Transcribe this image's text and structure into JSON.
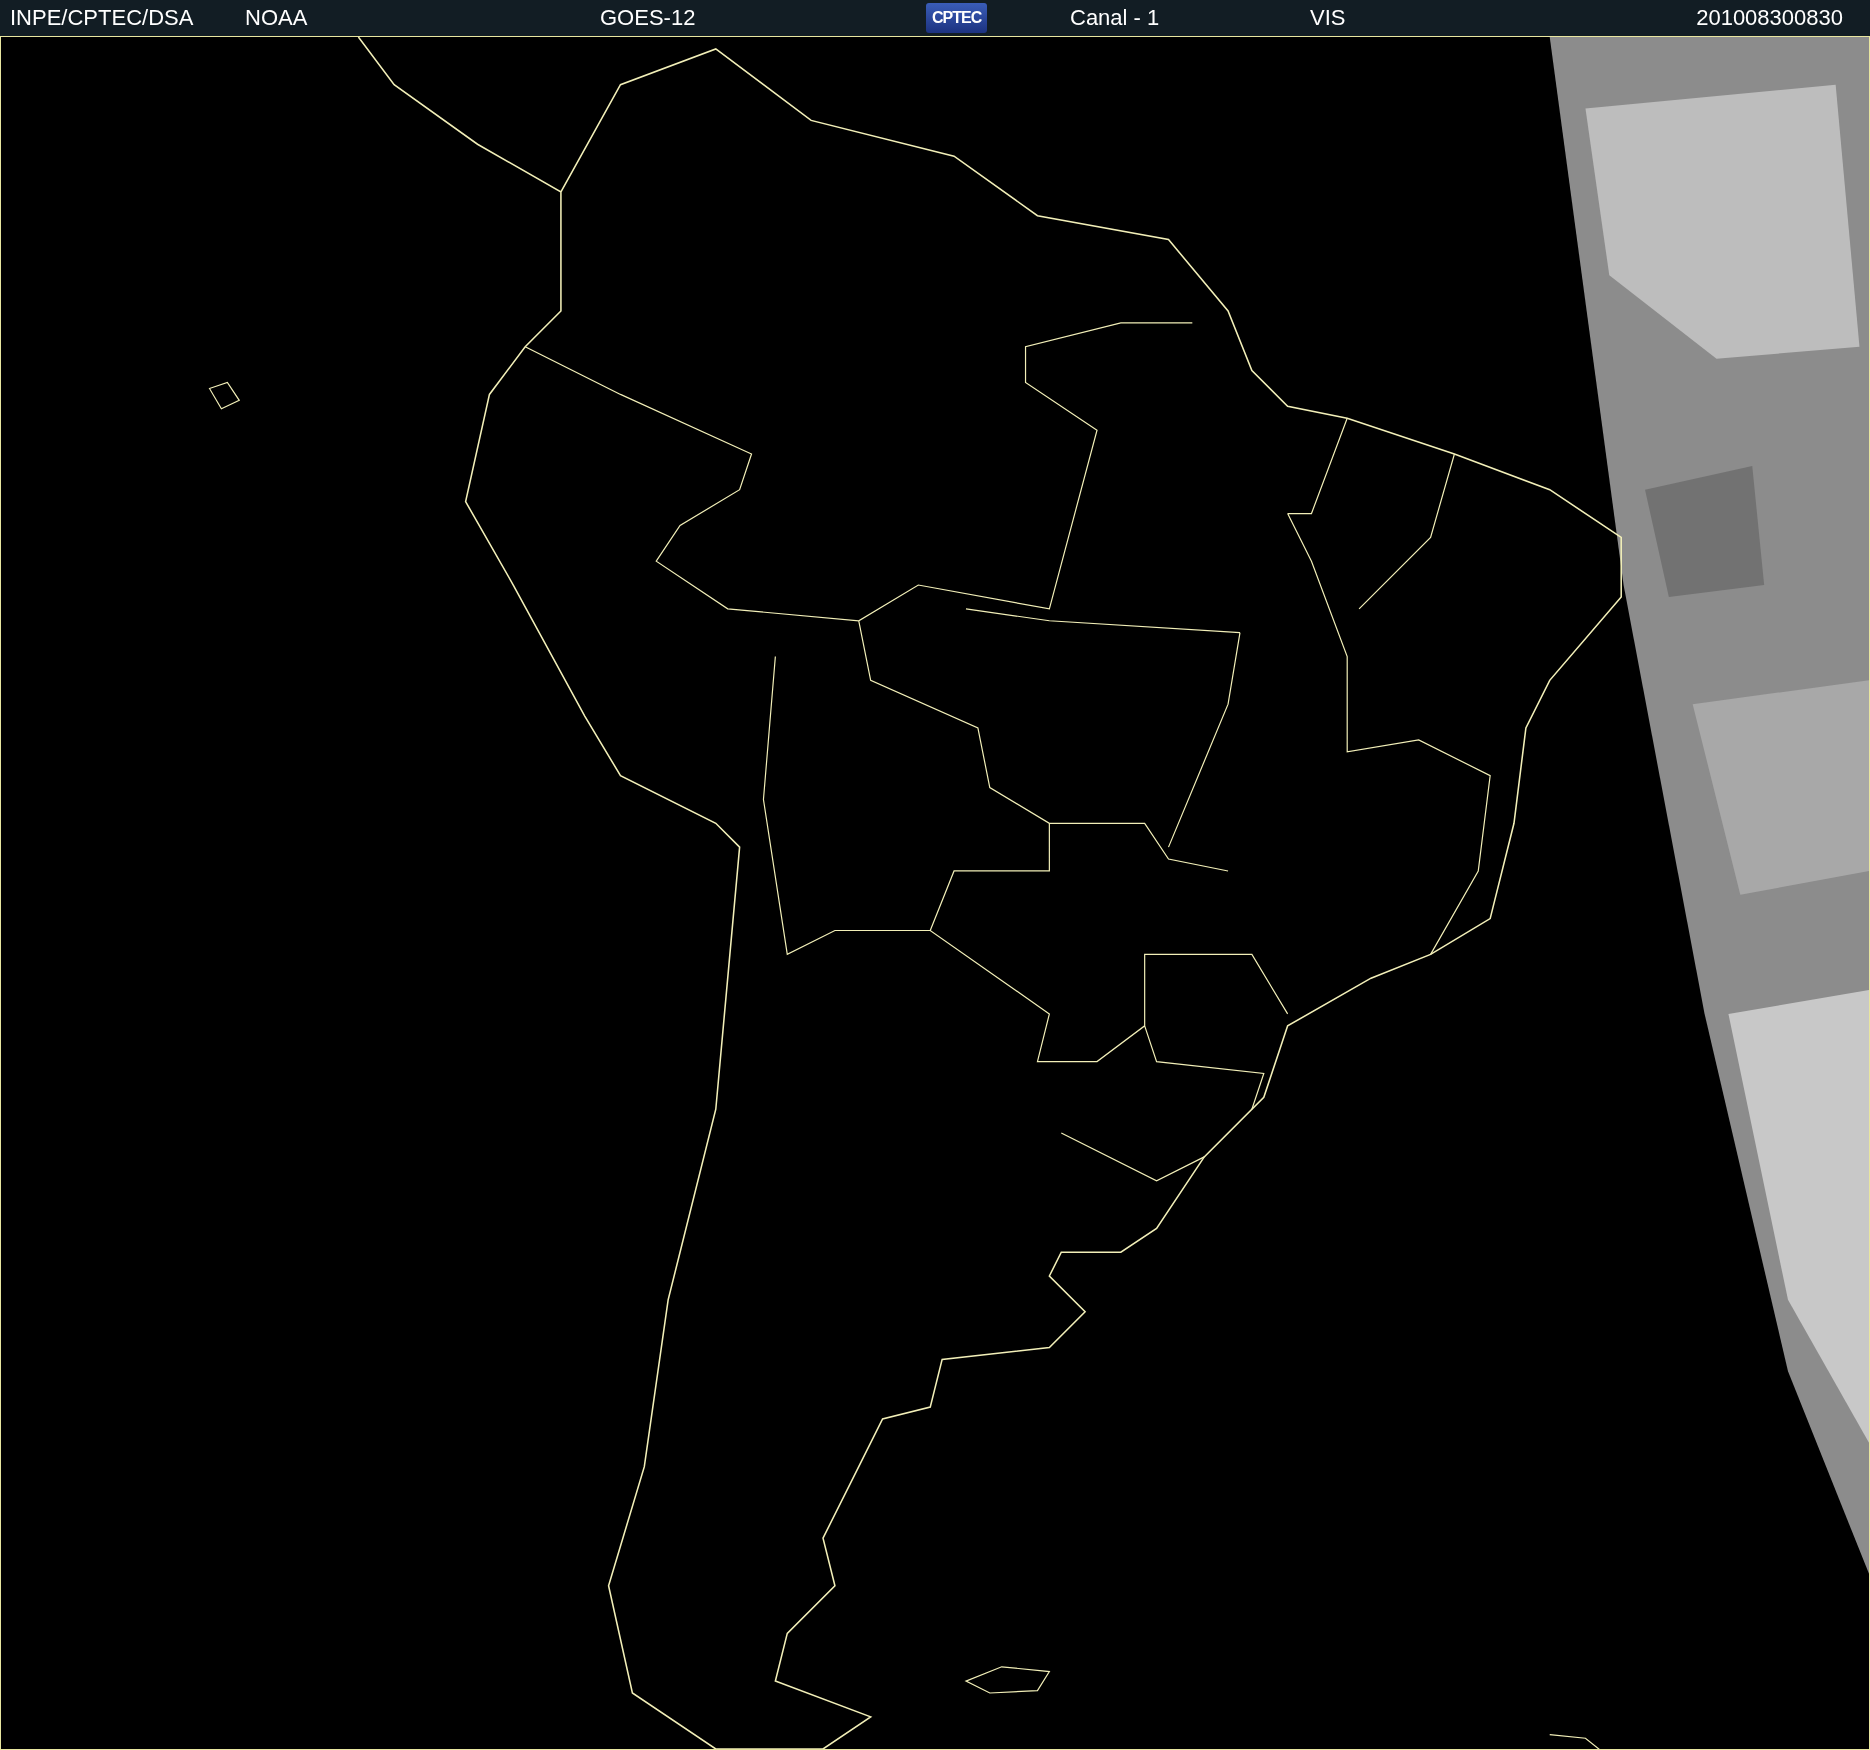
{
  "header": {
    "items": [
      {
        "kind": "text",
        "text": "INPE/CPTEC/DSA"
      },
      {
        "kind": "text",
        "text": "NOAA"
      },
      {
        "kind": "text",
        "text": "GOES-12"
      },
      {
        "kind": "logo",
        "text": "CPTEC"
      },
      {
        "kind": "text",
        "text": "Canal - 1"
      },
      {
        "kind": "text",
        "text": "VIS"
      },
      {
        "kind": "text",
        "text": "201008300830"
      }
    ]
  }
}
